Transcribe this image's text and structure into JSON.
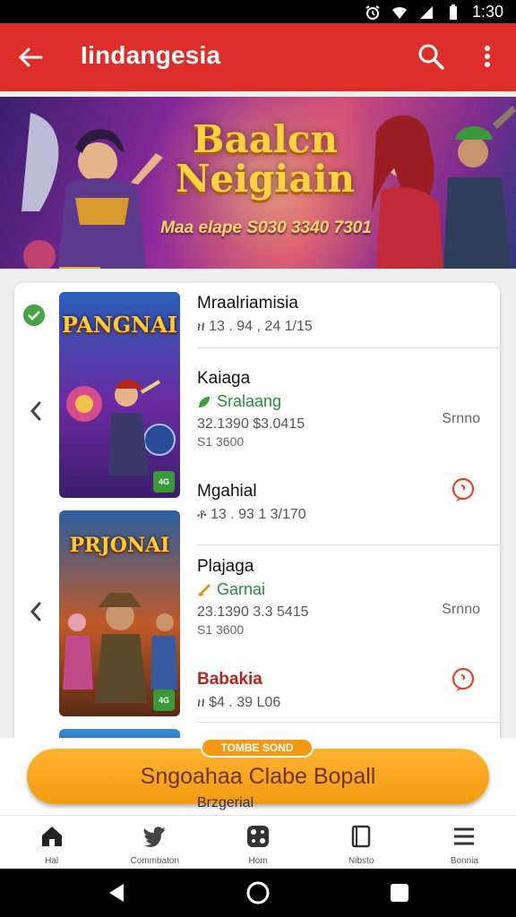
{
  "status_bar": {
    "time": "1:30",
    "icons": [
      "alarm-icon",
      "wifi-icon",
      "signal-icon",
      "battery-icon"
    ]
  },
  "app_bar": {
    "title": "Iindangesia",
    "icons": [
      "back-arrow-icon",
      "search-icon",
      "more-vert-icon"
    ]
  },
  "banner": {
    "title_line1": "Baalcn",
    "title_line2": "Neigiain",
    "subtitle": "Maa elape S030 3340 7301"
  },
  "list": {
    "item1": {
      "poster_title": "PANGNAI",
      "poster_subtitle": "",
      "rows": [
        {
          "name": "Mraalriamisia",
          "meta": "ዘ 13 . 94 , 24 1/15"
        },
        {
          "name": "Kaiaga",
          "tag": "Sralaang",
          "meta": "32.1390 $3.0415",
          "meta2": "S1 3600",
          "side": "Srnno"
        },
        {
          "name": "Mgahial",
          "meta": "ቶ 13 . 93 1 3/170"
        }
      ]
    },
    "item2": {
      "poster_title": "PRJONAI",
      "rows": [
        {
          "name": "Plajaga",
          "tag": "Garnai",
          "meta": "23.1390 3.3 5415",
          "meta2": "S1 3600",
          "side": "Srnno"
        },
        {
          "name": "Babakia",
          "meta": "ዘ $4 . 39 L06"
        }
      ]
    },
    "peek_label": "Brzgerial"
  },
  "cta": {
    "badge": "TOMBE SOND",
    "label": "Sngoahaa Clabe Bopall"
  },
  "bottom_nav": [
    {
      "label": "Hal",
      "icon": "home-icon"
    },
    {
      "label": "Commbaton",
      "icon": "bird-icon"
    },
    {
      "label": "Hom",
      "icon": "game-icon"
    },
    {
      "label": "Nibsto",
      "icon": "book-icon"
    },
    {
      "label": "Bonnia",
      "icon": "menu-icon"
    }
  ],
  "colors": {
    "app_bar": "#dd2e2a",
    "accent": "#f39a12",
    "success": "#46a447"
  }
}
